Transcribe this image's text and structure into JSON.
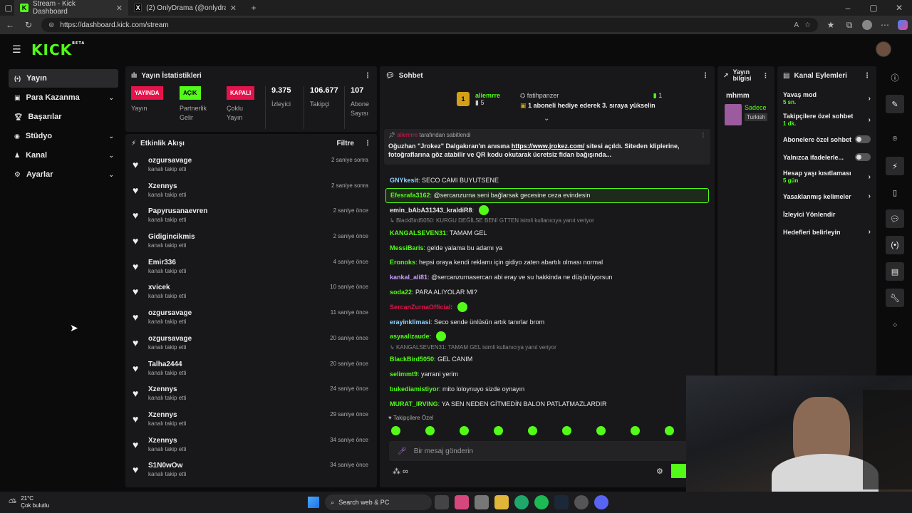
{
  "browser": {
    "tabs": [
      {
        "title": "Stream - Kick Dashboard",
        "active": true
      },
      {
        "title": "(2) OnlyDrama (@onlydramaX) / X",
        "active": false
      }
    ],
    "url": "https://dashboard.kick.com/stream"
  },
  "brand": {
    "logo": "KICK",
    "beta": "BETA",
    "accent": "#53fc18"
  },
  "sidebar": {
    "items": [
      {
        "label": "Yayın",
        "icon": "broadcast-icon",
        "active": true,
        "expandable": false
      },
      {
        "label": "Para Kazanma",
        "icon": "money-icon",
        "active": false,
        "expandable": true
      },
      {
        "label": "Başarılar",
        "icon": "trophy-icon",
        "active": false,
        "expandable": false
      },
      {
        "label": "Stüdyo",
        "icon": "studio-icon",
        "active": false,
        "expandable": true
      },
      {
        "label": "Kanal",
        "icon": "channel-icon",
        "active": false,
        "expandable": true
      },
      {
        "label": "Ayarlar",
        "icon": "gear-icon",
        "active": false,
        "expandable": true
      }
    ]
  },
  "stats": {
    "title": "Yayın İstatistikleri",
    "items": [
      {
        "badge": "YAYINDA",
        "label": "Yayın",
        "color": "#e5134b"
      },
      {
        "badge": "AÇIK",
        "label": "Partnerlik Gelir",
        "color": "#53fc18"
      },
      {
        "badge": "KAPALI",
        "label": "Çoklu Yayın",
        "color": "#e5134b"
      },
      {
        "value": "9.375",
        "label": "İzleyici"
      },
      {
        "value": "106.677",
        "label": "Takipçi"
      },
      {
        "value": "107",
        "label": "Abone Sayısı"
      }
    ]
  },
  "activity": {
    "title": "Etkinlik Akışı",
    "filter": "Filtre",
    "rows": [
      {
        "name": "ozgursavage",
        "sub": "kanalı takip etti",
        "time": "2 saniye sonra"
      },
      {
        "name": "Xzennys",
        "sub": "kanalı takip etti",
        "time": "2 saniye sonra"
      },
      {
        "name": "Papyrusanaevren",
        "sub": "kanalı takip etti",
        "time": "2 saniye önce"
      },
      {
        "name": "Gidigincikmis",
        "sub": "kanalı takip etti",
        "time": "2 saniye önce"
      },
      {
        "name": "Emir336",
        "sub": "kanalı takip etti",
        "time": "4 saniye önce"
      },
      {
        "name": "xvicek",
        "sub": "kanalı takip etti",
        "time": "10 saniye önce"
      },
      {
        "name": "ozgursavage",
        "sub": "kanalı takip etti",
        "time": "11 saniye önce"
      },
      {
        "name": "ozgursavage",
        "sub": "kanalı takip etti",
        "time": "20 saniye önce"
      },
      {
        "name": "Talha2444",
        "sub": "kanalı takip etti",
        "time": "20 saniye önce"
      },
      {
        "name": "Xzennys",
        "sub": "kanalı takip etti",
        "time": "24 saniye önce"
      },
      {
        "name": "Xzennys",
        "sub": "kanalı takip etti",
        "time": "29 saniye önce"
      },
      {
        "name": "Xzennys",
        "sub": "kanalı takip etti",
        "time": "34 saniye önce"
      },
      {
        "name": "S1N0wOw",
        "sub": "kanalı takip etti",
        "time": "34 saniye önce"
      }
    ]
  },
  "chat": {
    "title": "Sohbet",
    "gift": {
      "rank": "1",
      "user": "aliemrre",
      "count": "5",
      "gifter": "fatihpanzer",
      "gifter_count": "1",
      "text": "1 aboneli hediye ederek 3. sıraya yükselin"
    },
    "pinned": {
      "by": "tarafından sabitlendi",
      "text_a": "Oğuzhan \"Jrokez\" Dalgakıran'ın anısına ",
      "link": "https://www.jrokez.com/",
      "text_b": " sitesi açıldı. Siteden kliplerine, fotoğraflarına göz atabilir ve QR kodu okutarak ücretsiz fidan bağışında..."
    },
    "messages": [
      {
        "user": "GNYkesit",
        "color": "#8fd3ff",
        "text": "SECO CAMI BUYUTSENE"
      },
      {
        "user": "Efesrafa3162",
        "color": "#53fc18",
        "text": "@sercanzurna seni bağlarsak gecesine ceza evindesin",
        "highlight": true
      },
      {
        "user": "emin_bAbA31343_kraldiR8",
        "color": "#e8e8e8",
        "text": "",
        "emote": true
      },
      {
        "reply": "BlackBird5050: KURGU DEĞİLSE BENİ GTTEN isimli kullanıcıya yanıt veriyor"
      },
      {
        "user": "KANGALSEVEN31",
        "color": "#53fc18",
        "text": "TAMAM GEL"
      },
      {
        "user": "MessiBaris",
        "color": "#53fc18",
        "text": "gelde yalama bu adamı ya"
      },
      {
        "user": "Eronoks",
        "color": "#53fc18",
        "text": "hepsi oraya kendi reklamı için gidiyo zaten abartılı olması normal"
      },
      {
        "user": "kankal_ali81",
        "color": "#c99bff",
        "text": "@sercanzurnasercan abi eray ve su hakkinda ne düşünüyorsun"
      },
      {
        "user": "soda22",
        "color": "#53fc18",
        "text": "PARA ALIYOLAR MI?"
      },
      {
        "user": "SercanZurnaOfficial",
        "color": "#e5134b",
        "text": "",
        "emote": true
      },
      {
        "user": "erayinklimasi",
        "color": "#8fd3ff",
        "text": "Seco sende ünlüsün artık tanırlar brom"
      },
      {
        "user": "asyaalizaude",
        "color": "#53fc18",
        "text": "",
        "emote": true
      },
      {
        "reply": "KANGALSEVEN31: TAMAM GEL isimli kullanıcıya yanıt veriyor"
      },
      {
        "user": "BlackBird5050",
        "color": "#53fc18",
        "text": "GEL CANIM"
      },
      {
        "user": "selimmt9",
        "color": "#53fc18",
        "text": "yarrani yerim"
      },
      {
        "user": "bukediamistiyor",
        "color": "#53fc18",
        "text": "mito loloynuyo sizde oynayın"
      },
      {
        "user": "MURAT_IRVING",
        "color": "#53fc18",
        "text": "YA SEN NEDEN GİTMEDİN BALON PATLATMAZLARDIR"
      }
    ],
    "followers_only": "Takipçilere Özel",
    "input_placeholder": "Bir mesaj gönderin",
    "send": "Gö"
  },
  "info": {
    "title": "Yayın bilgisi",
    "name": "mhmm",
    "category": "Sadece",
    "lang": "Turkish"
  },
  "actions": {
    "title": "Kanal Eylemleri",
    "items": [
      {
        "label": "Yavaş mod",
        "sub": "5 sn.",
        "kind": "chevron"
      },
      {
        "label": "Takipçilere özel sohbet",
        "sub": "1 dk.",
        "kind": "chevron"
      },
      {
        "label": "Abonelere özel sohbet",
        "sub": "",
        "kind": "toggle"
      },
      {
        "label": "Yalnızca ifadelerle...",
        "sub": "",
        "kind": "toggle"
      },
      {
        "label": "Hesap yaşı kısıtlaması",
        "sub": "5 gün",
        "kind": "chevron"
      },
      {
        "label": "Yasaklanmış kelimeler",
        "sub": "",
        "kind": "chevron"
      },
      {
        "label": "İzleyici Yönlendir",
        "sub": "",
        "kind": "none"
      },
      {
        "label": "Hedefleri belirleyin",
        "sub": "",
        "kind": "chevron"
      }
    ]
  },
  "taskbar": {
    "temp": "21°C",
    "weather": "Çok bulutlu",
    "search": "Search web & PC"
  }
}
